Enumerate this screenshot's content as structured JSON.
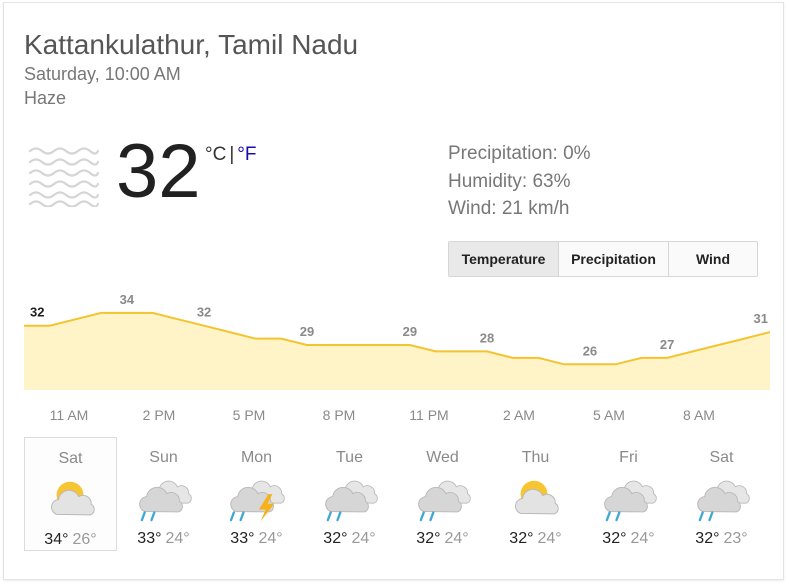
{
  "location": "Kattankulathur, Tamil Nadu",
  "datetime": "Saturday, 10:00 AM",
  "condition": "Haze",
  "current": {
    "temp": "32",
    "unit_c": "°C",
    "separator": "|",
    "unit_f": "°F",
    "icon": "haze-icon"
  },
  "details": {
    "precipitation": "Precipitation: 0%",
    "humidity": "Humidity: 63%",
    "wind": "Wind: 21 km/h"
  },
  "tabs": [
    {
      "label": "Temperature",
      "active": true
    },
    {
      "label": "Precipitation",
      "active": false
    },
    {
      "label": "Wind",
      "active": false
    }
  ],
  "colors": {
    "chart_line": "#f4c430",
    "chart_fill": "#fff4c7",
    "link": "#1a0dab",
    "rain": "#3fa7d6",
    "sun": "#f7c531",
    "lightning": "#f6b21a",
    "cloud": "#c9c9c9"
  },
  "chart_data": {
    "type": "area",
    "x": [
      "11 AM",
      "2 PM",
      "5 PM",
      "8 PM",
      "11 PM",
      "2 AM",
      "5 AM",
      "8 AM"
    ],
    "labels": [
      "32",
      "34",
      "32",
      "29",
      "29",
      "28",
      "26",
      "27",
      "31"
    ],
    "series": [
      {
        "name": "Temperature",
        "values": [
          32,
          32,
          33,
          34,
          34,
          34,
          33,
          32,
          31,
          30,
          30,
          29,
          29,
          29,
          29,
          29,
          28,
          28,
          28,
          27,
          27,
          26,
          26,
          26,
          27,
          27,
          28,
          29,
          30,
          31
        ]
      }
    ],
    "ylim": [
      22,
      36
    ]
  },
  "forecast": [
    {
      "day": "Sat",
      "hi": "34°",
      "lo": "26°",
      "icon": "partly-cloudy-icon",
      "selected": true
    },
    {
      "day": "Sun",
      "hi": "33°",
      "lo": "24°",
      "icon": "rain-icon",
      "selected": false
    },
    {
      "day": "Mon",
      "hi": "33°",
      "lo": "24°",
      "icon": "thunderstorm-icon",
      "selected": false
    },
    {
      "day": "Tue",
      "hi": "32°",
      "lo": "24°",
      "icon": "rain-icon",
      "selected": false
    },
    {
      "day": "Wed",
      "hi": "32°",
      "lo": "24°",
      "icon": "rain-icon",
      "selected": false
    },
    {
      "day": "Thu",
      "hi": "32°",
      "lo": "24°",
      "icon": "partly-cloudy-icon",
      "selected": false
    },
    {
      "day": "Fri",
      "hi": "32°",
      "lo": "24°",
      "icon": "rain-icon",
      "selected": false
    },
    {
      "day": "Sat",
      "hi": "32°",
      "lo": "23°",
      "icon": "rain-icon",
      "selected": false
    }
  ]
}
